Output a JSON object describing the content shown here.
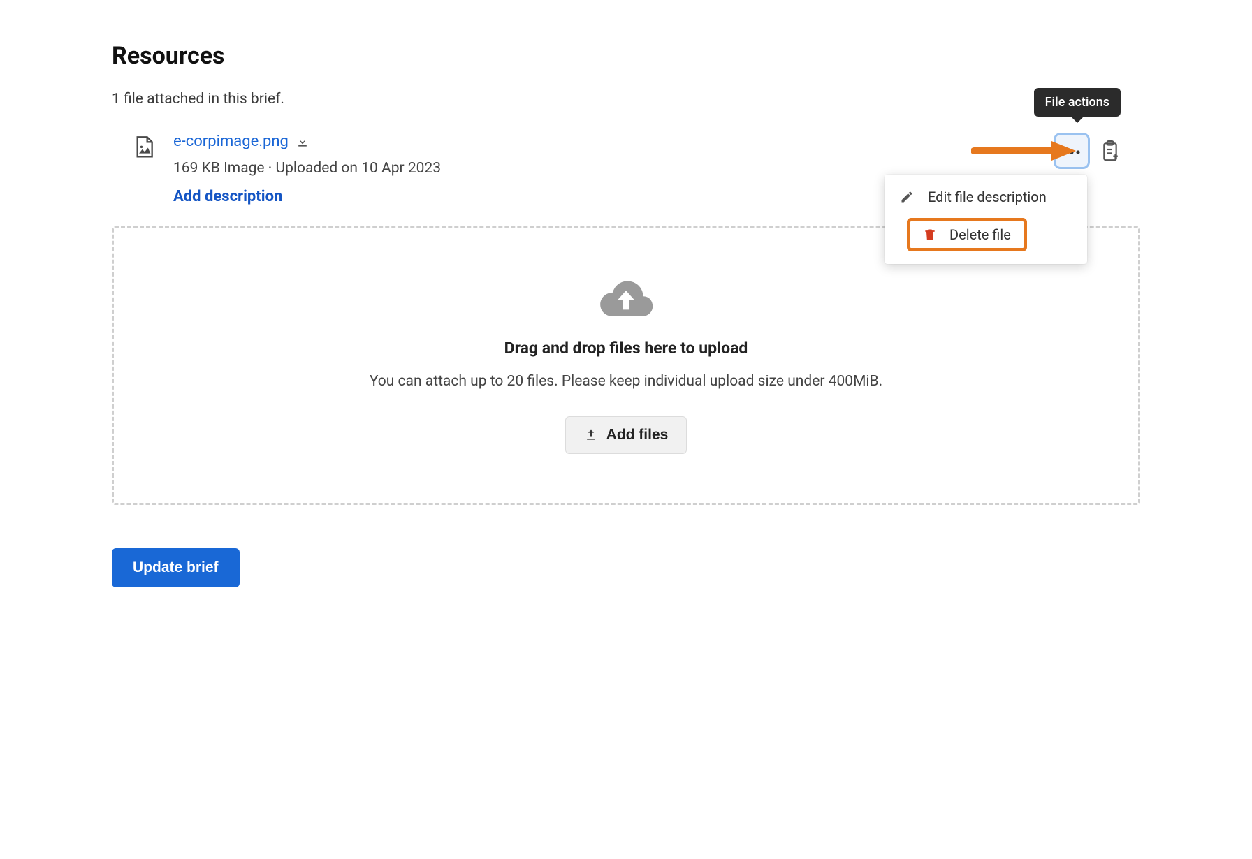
{
  "header": {
    "title": "Resources",
    "subtitle": "1 file attached in this brief."
  },
  "file": {
    "name": "e-corpimage.png",
    "meta": "169 KB Image · Uploaded on 10 Apr 2023",
    "add_description": "Add description"
  },
  "tooltip": "File actions",
  "menu": {
    "edit": "Edit file description",
    "delete": "Delete file"
  },
  "dropzone": {
    "title": "Drag and drop files here to upload",
    "subtitle": "You can attach up to 20 files. Please keep individual upload size under 400MiB.",
    "button": "Add files"
  },
  "footer": {
    "update_button": "Update brief"
  }
}
